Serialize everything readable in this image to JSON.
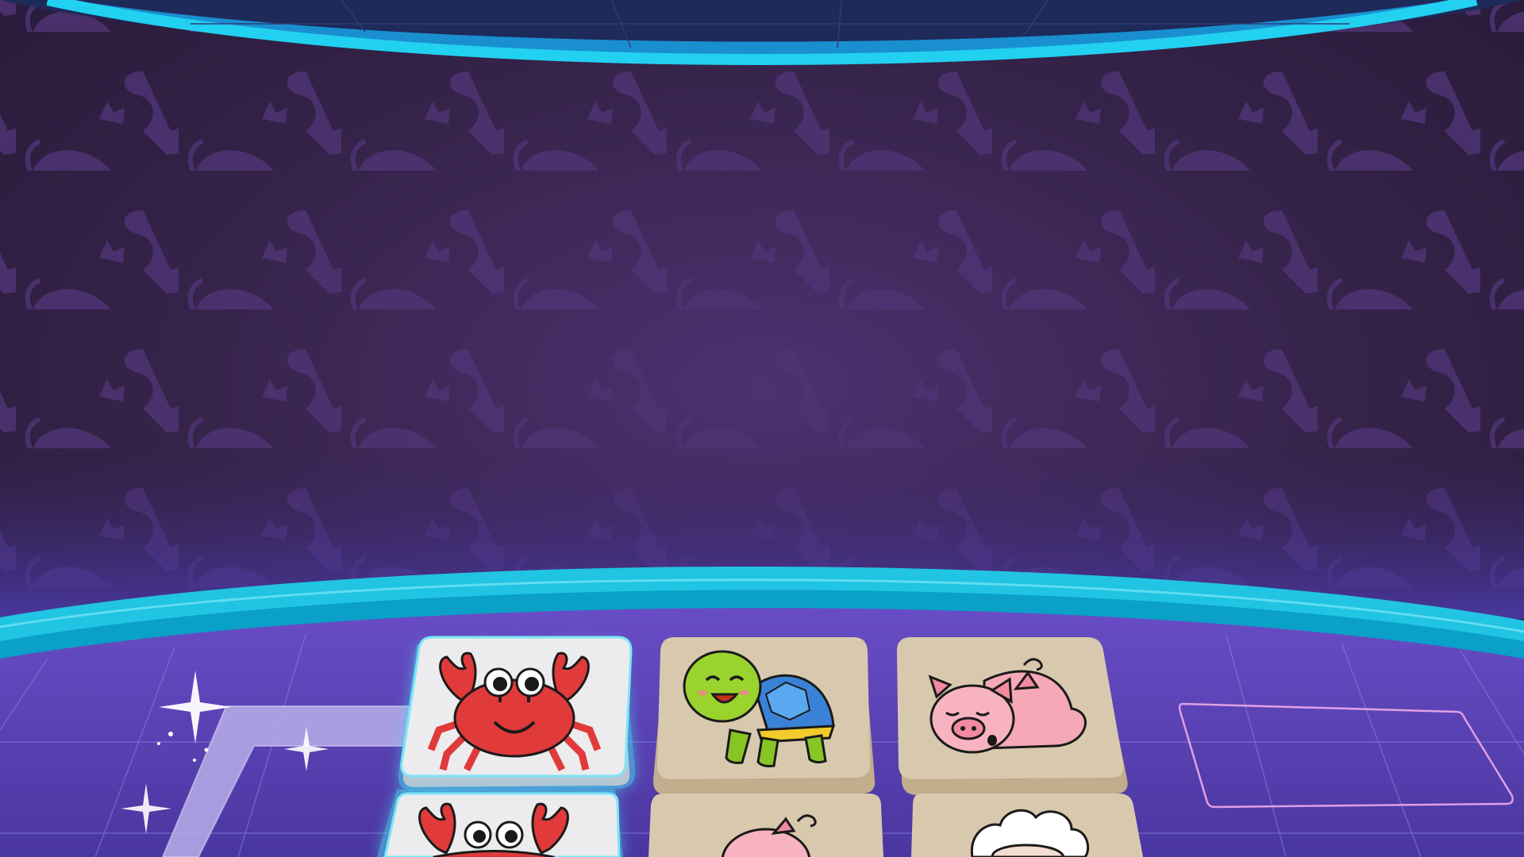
{
  "game": {
    "type": "tile-matching",
    "theme": {
      "wall": "#3a2656",
      "wall_glow": "#5a3680",
      "pattern": "#4e3373",
      "rim": "#1ec8e8",
      "rim_dark": "#0aa0c8",
      "floor": "#5a47b8",
      "floor_grid": "#8b7fd8",
      "tile_face": "#d8c9ae",
      "tile_selected": "#e9e9ea",
      "tile_glow": "#4ad8f0",
      "slot_outline": "#e8a8e8"
    },
    "board": {
      "tiles": [
        {
          "animal": "crab-icon",
          "row": 1,
          "col": 1,
          "selected": true
        },
        {
          "animal": "turtle-icon",
          "row": 1,
          "col": 2,
          "selected": false
        },
        {
          "animal": "pig-icon",
          "row": 1,
          "col": 3,
          "selected": false
        },
        {
          "animal": "crab-icon",
          "row": 2,
          "col": 1,
          "selected": true
        },
        {
          "animal": "pig-icon",
          "row": 2,
          "col": 2,
          "selected": false
        },
        {
          "animal": "sheep-icon",
          "row": 2,
          "col": 3,
          "selected": false
        }
      ],
      "empty_slot": "tile-slot-outline",
      "path_connector": "match-path"
    }
  }
}
